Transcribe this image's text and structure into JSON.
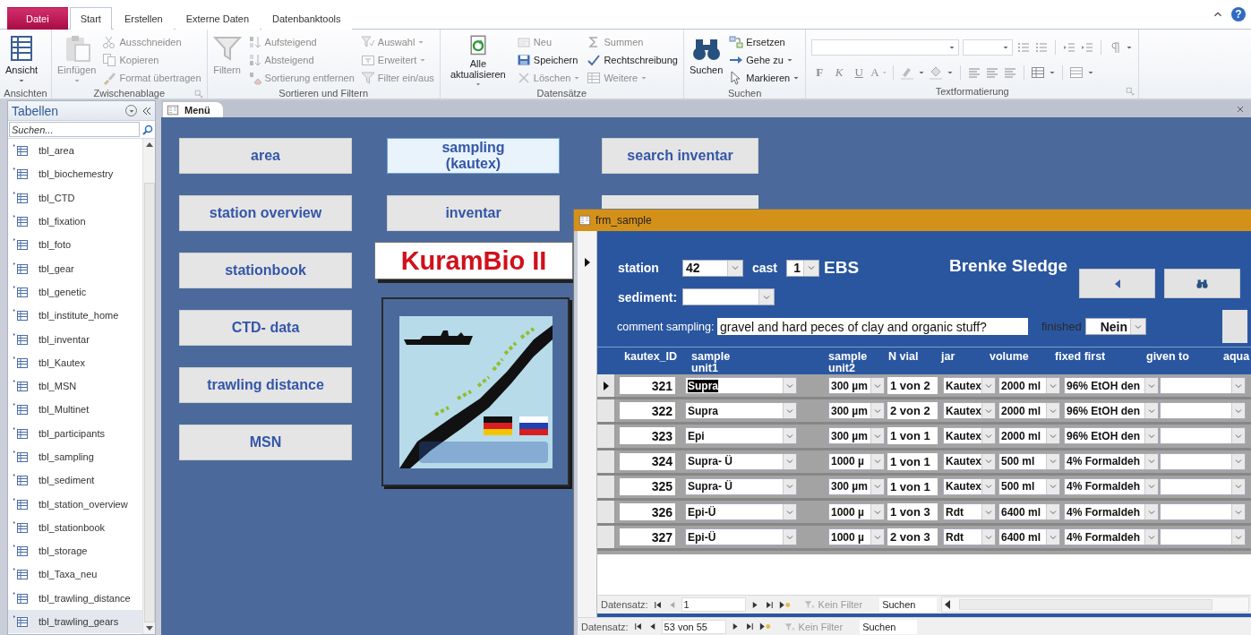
{
  "ribbon": {
    "tabs": [
      {
        "label": "Datei",
        "kind": "file",
        "selected": false
      },
      {
        "label": "Start",
        "kind": "tab",
        "selected": true
      },
      {
        "label": "Erstellen",
        "kind": "tab",
        "selected": false
      },
      {
        "label": "Externe Daten",
        "kind": "tab",
        "selected": false
      },
      {
        "label": "Datenbanktools",
        "kind": "tab",
        "selected": false
      }
    ],
    "help": "?",
    "groups": [
      {
        "label": "Ansichten",
        "items": [
          {
            "label": "Ansicht",
            "kind": "large",
            "dropdown": true,
            "disabled": false
          }
        ]
      },
      {
        "label": "Zwischenablage",
        "launcher": true,
        "items": [
          {
            "label": "Einfügen",
            "kind": "large",
            "dropdown": true,
            "disabled": true
          },
          {
            "label": "Ausschneiden",
            "kind": "small",
            "disabled": true
          },
          {
            "label": "Kopieren",
            "kind": "small",
            "disabled": true
          },
          {
            "label": "Format übertragen",
            "kind": "small",
            "disabled": true
          }
        ]
      },
      {
        "label": "Sortieren und Filtern",
        "items": [
          {
            "label": "Filtern",
            "kind": "large",
            "disabled": true
          },
          {
            "label": "Aufsteigend",
            "kind": "small",
            "disabled": true
          },
          {
            "label": "Absteigend",
            "kind": "small",
            "disabled": true
          },
          {
            "label": "Sortierung entfernen",
            "kind": "small",
            "disabled": true
          },
          {
            "label": "Auswahl",
            "kind": "small",
            "dropdown": true,
            "disabled": true
          },
          {
            "label": "Erweitert",
            "kind": "small",
            "dropdown": true,
            "disabled": true
          },
          {
            "label": "Filter ein/aus",
            "kind": "small",
            "disabled": true
          }
        ]
      },
      {
        "label": "Datensätze",
        "items": [
          {
            "label": "Alle aktualisieren",
            "kind": "large",
            "dropdown": true,
            "disabled": false
          },
          {
            "label": "Neu",
            "kind": "small",
            "disabled": true
          },
          {
            "label": "Speichern",
            "kind": "small",
            "disabled": false
          },
          {
            "label": "Löschen",
            "kind": "small",
            "dropdown": true,
            "disabled": true
          },
          {
            "label": "Summen",
            "kind": "small",
            "disabled": true
          },
          {
            "label": "Rechtschreibung",
            "kind": "small",
            "disabled": false
          },
          {
            "label": "Weitere",
            "kind": "small",
            "dropdown": true,
            "disabled": true
          }
        ]
      },
      {
        "label": "Suchen",
        "items": [
          {
            "label": "Suchen",
            "kind": "large",
            "disabled": false
          },
          {
            "label": "Ersetzen",
            "kind": "small",
            "disabled": false
          },
          {
            "label": "Gehe zu",
            "kind": "small",
            "dropdown": true,
            "disabled": false
          },
          {
            "label": "Markieren",
            "kind": "small",
            "dropdown": true,
            "disabled": false
          }
        ]
      }
    ],
    "text_format": {
      "label": "Textformatierung",
      "launcher": true,
      "buttons": [
        {
          "label": "F",
          "disabled": true
        },
        {
          "label": "K",
          "disabled": true
        },
        {
          "label": "U",
          "disabled": true
        },
        {
          "label": "A",
          "disabled": true
        }
      ]
    }
  },
  "navigation_pane": {
    "title": "Tabellen",
    "search_placeholder": "Suchen...",
    "items": [
      {
        "label": "tbl_area",
        "selected": false
      },
      {
        "label": "tbl_biochemestry",
        "selected": false
      },
      {
        "label": "tbl_CTD",
        "selected": false
      },
      {
        "label": "tbl_fixation",
        "selected": false
      },
      {
        "label": "tbl_foto",
        "selected": false
      },
      {
        "label": "tbl_gear",
        "selected": false
      },
      {
        "label": "tbl_genetic",
        "selected": false
      },
      {
        "label": "tbl_institute_home",
        "selected": false
      },
      {
        "label": "tbl_inventar",
        "selected": false
      },
      {
        "label": "tbl_Kautex",
        "selected": false
      },
      {
        "label": "tbl_MSN",
        "selected": false
      },
      {
        "label": "tbl_Multinet",
        "selected": false
      },
      {
        "label": "tbl_participants",
        "selected": false
      },
      {
        "label": "tbl_sampling",
        "selected": false
      },
      {
        "label": "tbl_sediment",
        "selected": false
      },
      {
        "label": "tbl_station_overview",
        "selected": false
      },
      {
        "label": "tbl_stationbook",
        "selected": false
      },
      {
        "label": "tbl_storage",
        "selected": false
      },
      {
        "label": "tbl_Taxa_neu",
        "selected": false
      },
      {
        "label": "tbl_trawling_distance",
        "selected": false
      },
      {
        "label": "tbl_trawling_gears",
        "selected": true
      }
    ]
  },
  "document_tabs": [
    {
      "label": "Menü",
      "selected": true
    }
  ],
  "menu": {
    "left_buttons": [
      {
        "label": "area",
        "selected": false
      },
      {
        "label": "station overview",
        "selected": false
      },
      {
        "label": "stationbook",
        "selected": false
      },
      {
        "label": "CTD- data",
        "selected": false
      },
      {
        "label": "trawling distance",
        "selected": false
      },
      {
        "label": "MSN",
        "selected": false
      }
    ],
    "middle_buttons": [
      {
        "label": "sampling\n(kautex)",
        "selected": true
      },
      {
        "label": "inventar",
        "selected": false
      }
    ],
    "right_buttons": [
      {
        "label": "search inventar",
        "selected": false
      }
    ],
    "title": "KuramBio II"
  },
  "sample_form": {
    "title": "frm_sample",
    "selected": true,
    "station_label": "station",
    "station": "42",
    "cast_label": "cast",
    "cast": "1",
    "gear_code": "EBS",
    "gear_name": "Brenke Sledge",
    "sediment_label": "sediment:",
    "comment_label": "comment sampling:",
    "comment": "gravel and hard peces of clay and organic stuff?",
    "finished_label": "finished",
    "finished": "Nein",
    "columns": [
      {
        "label": "kautex_ID",
        "kind": "number"
      },
      {
        "label": "sample unit1",
        "kind": "combo"
      },
      {
        "label": "sample unit2",
        "kind": "combo"
      },
      {
        "label": "N vial",
        "kind": "text"
      },
      {
        "label": "jar",
        "kind": "combo"
      },
      {
        "label": "volume",
        "kind": "combo"
      },
      {
        "label": "fixed first",
        "kind": "combo"
      },
      {
        "label": "given to",
        "kind": "combo"
      },
      {
        "label": "aqua"
      }
    ],
    "rows": [
      {
        "selected": true,
        "cells": [
          "321",
          "Supra",
          "300 µm",
          "1 von 2",
          "Kautex",
          "2000 ml",
          "96% EtOH den"
        ]
      },
      {
        "selected": false,
        "cells": [
          "322",
          "Supra",
          "300 µm",
          "2 von 2",
          "Kautex",
          "2000 ml",
          "96% EtOH den"
        ]
      },
      {
        "selected": false,
        "cells": [
          "323",
          "Epi",
          "300 µm",
          "1 von 1",
          "Kautex",
          "2000 ml",
          "96% EtOH den"
        ]
      },
      {
        "selected": false,
        "cells": [
          "324",
          "Supra- Ü",
          "1000 µ",
          "1 von 1",
          "Kautex",
          "500 ml",
          "4% Formaldeh"
        ]
      },
      {
        "selected": false,
        "cells": [
          "325",
          "Supra- Ü",
          "300 µm",
          "1 von 1",
          "Kautex",
          "500 ml",
          "4% Formaldeh"
        ]
      },
      {
        "selected": false,
        "cells": [
          "326",
          "Epi-Ü",
          "1000 µ",
          "1 von 3",
          "Rdt",
          "6400 ml",
          "4% Formaldeh"
        ]
      },
      {
        "selected": false,
        "cells": [
          "327",
          "Epi-Ü",
          "1000 µ",
          "2 von 3",
          "Rdt",
          "6400 ml",
          "4% Formaldeh"
        ]
      }
    ],
    "navigator": {
      "label": "Datensatz:",
      "record": "1",
      "filter": "Kein Filter",
      "search": "Suchen"
    }
  },
  "record_navigator": {
    "label": "Datensatz:",
    "record": "53 von 55",
    "filter": "Kein Filter",
    "search": "Suchen"
  }
}
